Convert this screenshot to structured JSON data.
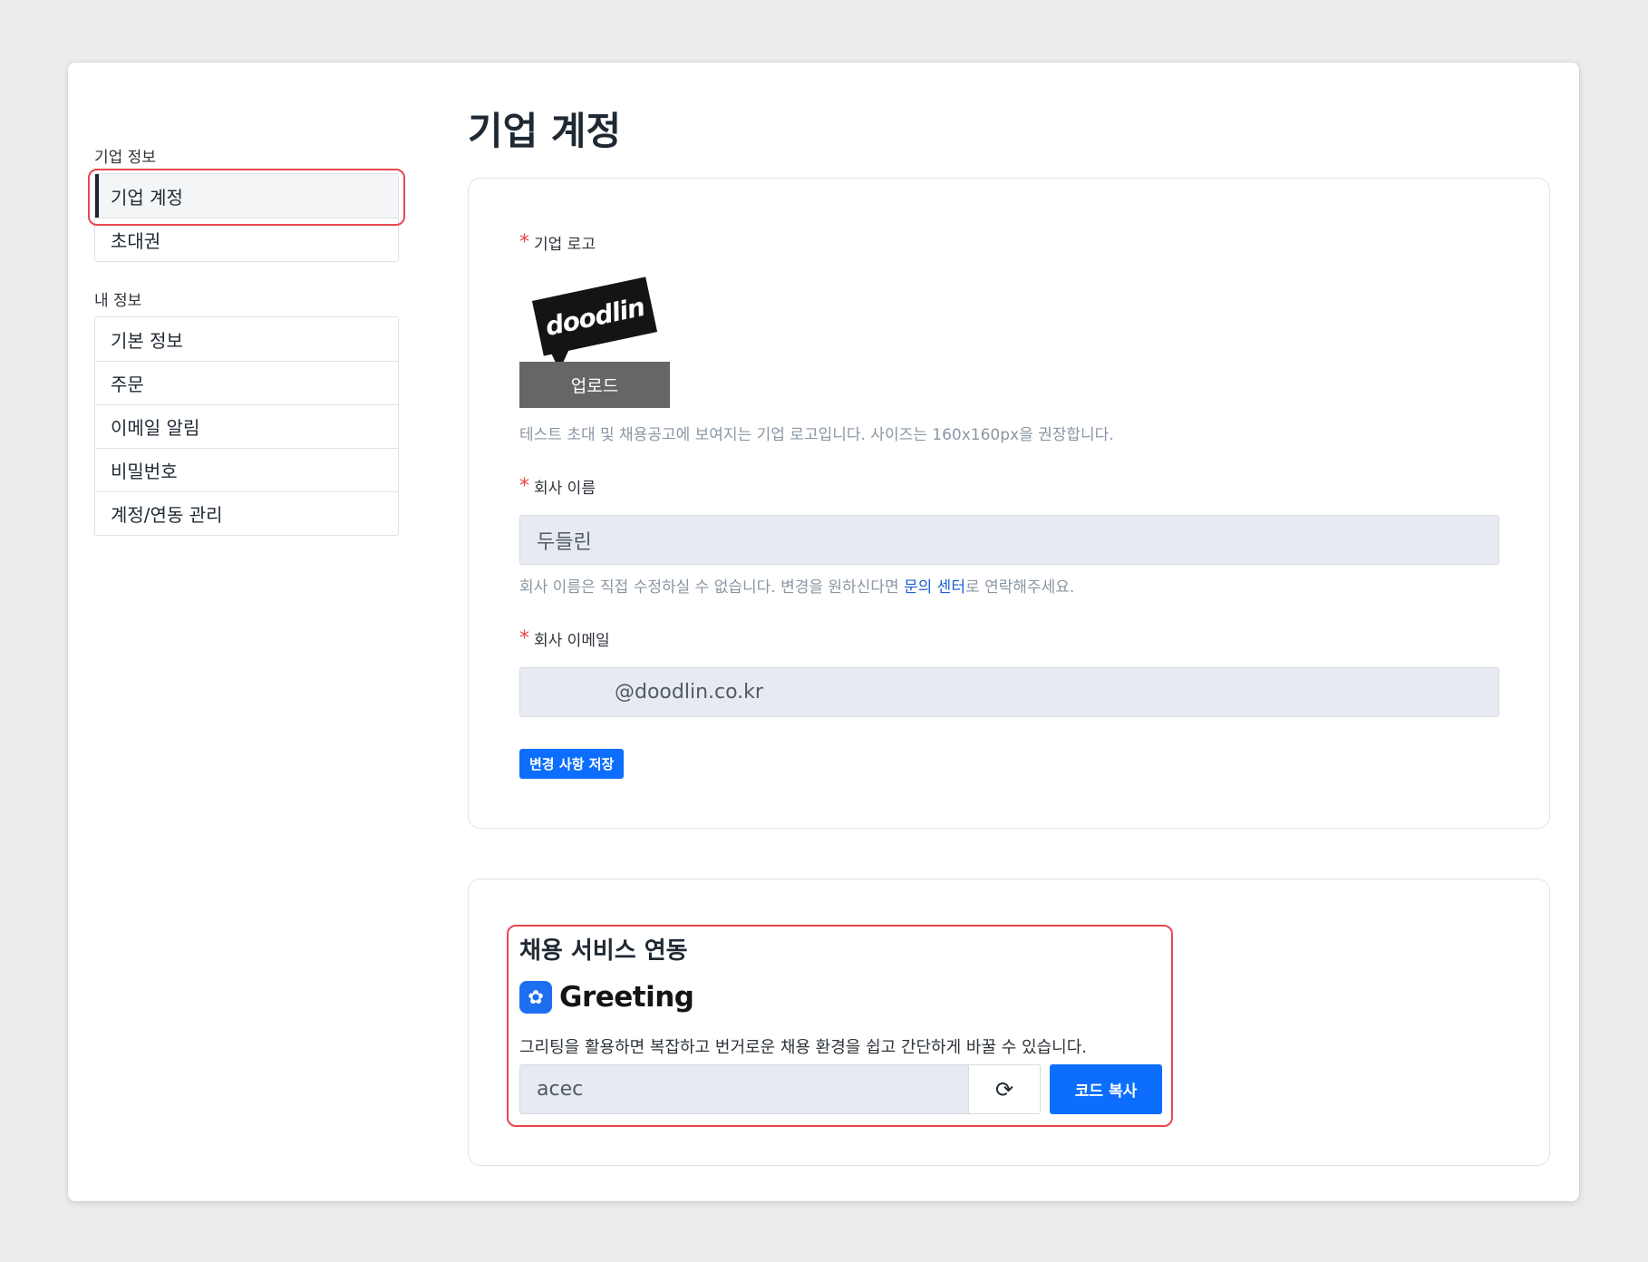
{
  "sidebar": {
    "groups": [
      {
        "title": "기업 정보",
        "items": [
          {
            "label": "기업 계정"
          },
          {
            "label": "초대권"
          }
        ]
      },
      {
        "title": "내 정보",
        "items": [
          {
            "label": "기본 정보"
          },
          {
            "label": "주문"
          },
          {
            "label": "이메일 알림"
          },
          {
            "label": "비밀번호"
          },
          {
            "label": "계정/연동 관리"
          }
        ]
      }
    ]
  },
  "page": {
    "title": "기업 계정"
  },
  "account_form": {
    "logo_label": "기업 로고",
    "logo_text": "doodlin",
    "upload_label": "업로드",
    "logo_help": "테스트 초대 및 채용공고에 보여지는 기업 로고입니다. 사이즈는 160x160px을 권장합니다.",
    "company_name_label": "회사 이름",
    "company_name_value": "두들린",
    "company_name_help_prefix": "회사 이름은 직접 수정하실 수 없습니다. 변경을 원하신다면 ",
    "company_name_help_link": "문의 센터",
    "company_name_help_suffix": "로 연락해주세요.",
    "company_email_label": "회사 이메일",
    "company_email_value": "@doodlin.co.kr",
    "save_label": "변경 사항 저장"
  },
  "integration": {
    "title": "채용 서비스 연동",
    "service_name": "Greeting",
    "description": "그리팅을 활용하면 복잡하고 번거로운 채용 환경을 쉽고 간단하게 바꿀 수 있습니다.",
    "code_value": "acec",
    "copy_label": "코드 복사"
  },
  "colors": {
    "accent": "#0d6efd",
    "highlight": "#e8474e",
    "required": "#e8473e"
  }
}
